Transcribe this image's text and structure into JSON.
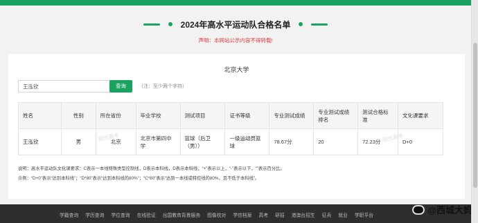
{
  "page": {
    "title": "2024年高水平运动队合格名单",
    "notice": "声明：本网站公示内容不得转载!"
  },
  "panel": {
    "university": "北京大学",
    "search_value": "王泓钦",
    "search_button": "查询",
    "search_hint": "（注：至少两个字符）",
    "watermark_text": "阳光高考"
  },
  "table": {
    "headers": [
      "姓名",
      "性别",
      "所在省份",
      "毕业学校",
      "测试项目",
      "证书等级",
      "专业测试成绩",
      "专业测试成绩排名",
      "测试合格标准",
      "文化课要求"
    ],
    "rows": [
      [
        "王泓钦",
        "男",
        "北京",
        "北京市第四中学",
        "篮球（后卫（男））",
        "一级运动员篮球",
        "78.67分",
        "20",
        "72.23分",
        "D+0"
      ]
    ]
  },
  "notes": {
    "line1": "说明：高水平运动队文化课要求：C表示一本线特殊类型控制线，D表示本科线，D表示本科线，“+”表示以上，“-”表示以下，“”表示百分比。",
    "line2": "示例：“D+0”表示“达到本科线”；“D*80”表示“达到本科线的80%”；“C*80”表示“达到一本线或特控线的80%，且不低于本科线”。"
  },
  "footer": {
    "links": [
      "学籍查询",
      "学历查询",
      "学位查询",
      "在线验证",
      "出国教育背景服务",
      "图像校对",
      "学信档案",
      "高考",
      "研招",
      "港澳台招生",
      "征兵",
      "就业",
      "学职平台"
    ]
  },
  "weibo": {
    "handle": "@西城大妈"
  }
}
